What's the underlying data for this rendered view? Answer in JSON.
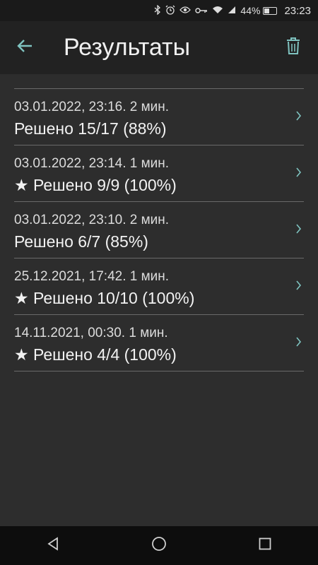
{
  "status_bar": {
    "battery": "44%",
    "battery_level": 0.44,
    "time": "23:23",
    "icons": [
      "bluetooth-icon",
      "alarm-icon",
      "eye-icon",
      "key-icon",
      "wifi-icon",
      "signal-icon",
      "battery-icon"
    ]
  },
  "app_bar": {
    "title": "Результаты",
    "back_icon": "arrow-left-icon",
    "delete_icon": "trash-icon"
  },
  "colors": {
    "accent": "#7fc3c0",
    "background": "#2d2d2d",
    "app_bar": "#222222",
    "divider": "#6a6a6a"
  },
  "results": [
    {
      "meta": "03.01.2022, 23:16. 2 мин.",
      "result": "Решено 15/17 (88%)"
    },
    {
      "meta": "03.01.2022, 23:14. 1 мин.",
      "result": "★ Решено 9/9 (100%)"
    },
    {
      "meta": "03.01.2022, 23:10. 2 мин.",
      "result": "Решено 6/7 (85%)"
    },
    {
      "meta": "25.12.2021, 17:42. 1 мин.",
      "result": "★ Решено 10/10 (100%)"
    },
    {
      "meta": "14.11.2021, 00:30. 1 мин.",
      "result": "★ Решено 4/4 (100%)"
    }
  ],
  "nav_bar": {
    "icons": [
      "back-triangle-icon",
      "home-circle-icon",
      "recents-square-icon"
    ]
  }
}
